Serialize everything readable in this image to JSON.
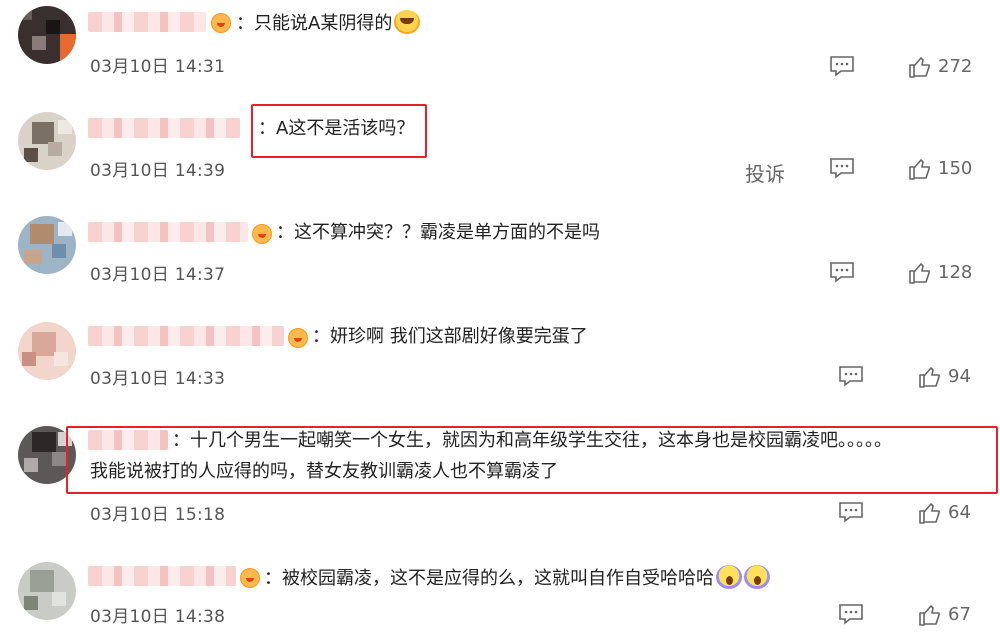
{
  "comments": [
    {
      "text": "：只能说A某阴得的",
      "time": "03月10日 14:31",
      "likes": "272",
      "emoji": "laugh-cry-icon"
    },
    {
      "text": "：A这不是活该吗？",
      "time": "03月10日 14:39",
      "likes": "150",
      "report": "投诉"
    },
    {
      "text": "：这不算冲突？？霸凌是单方面的不是吗",
      "time": "03月10日 14:37",
      "likes": "128"
    },
    {
      "text": "：妍珍啊 我们这部剧好像要完蛋了",
      "time": "03月10日 14:33",
      "likes": "94"
    },
    {
      "text": "：十几个男生一起嘲笑一个女生，就因为和高年级学生交往，这本身也是校园霸凌吧。。。。。",
      "text2": "我能说被打的人应得的吗，替女友教训霸凌人也不算霸凌了",
      "time": "03月10日 15:18",
      "likes": "64"
    },
    {
      "text": "：被校园霸凌，这不是应得的么，这就叫自作自受哈哈哈",
      "time": "03月10日 14:38",
      "likes": "67",
      "emoji": "scream-icon"
    }
  ],
  "colors": {
    "highlight": "#e8202a",
    "meta": "#666666"
  }
}
